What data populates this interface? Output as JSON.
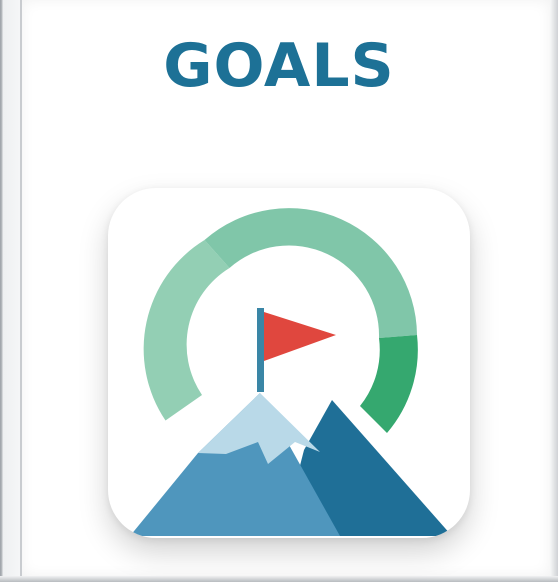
{
  "title": "GOALS",
  "icon": {
    "name": "goals-mountain-flag-icon",
    "colors": {
      "title": "#1d7196",
      "ring_light": "#8ccbb0",
      "ring_mid": "#7fc3a8",
      "ring_dark": "#35a86f",
      "flag": "#e0473e",
      "pole": "#3a86a6",
      "snow": "#b9d9e8",
      "mountain_left": "#4f96bd",
      "mountain_right": "#1f6f97"
    }
  }
}
